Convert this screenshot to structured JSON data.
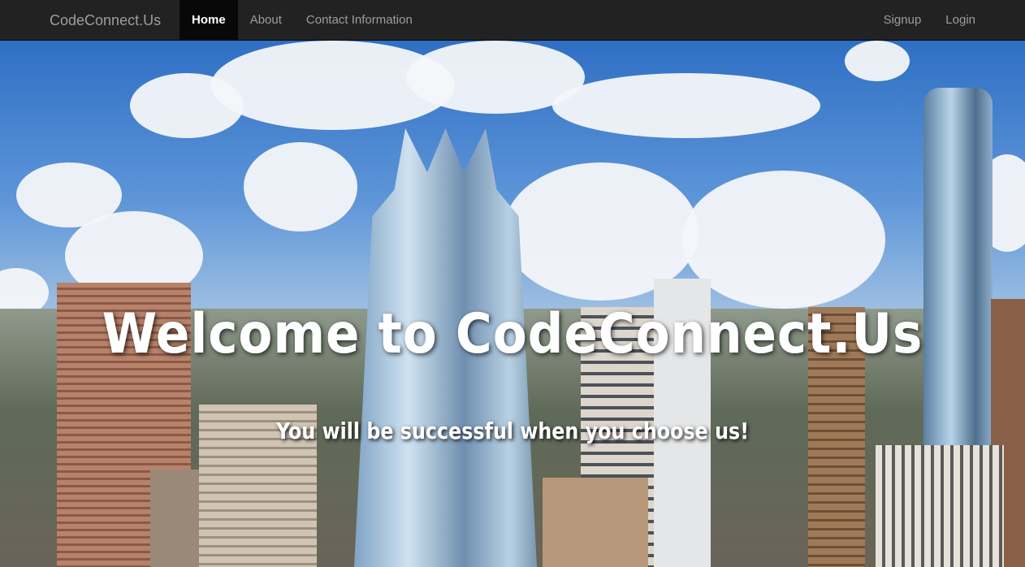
{
  "navbar": {
    "brand": "CodeConnect.Us",
    "left_links": [
      {
        "label": "Home",
        "active": true
      },
      {
        "label": "About",
        "active": false
      },
      {
        "label": "Contact Information",
        "active": false
      }
    ],
    "right_links": [
      {
        "label": "Signup"
      },
      {
        "label": "Login"
      }
    ]
  },
  "hero": {
    "title": "Welcome to CodeConnect.Us",
    "subtitle": "You will be successful when you choose us!",
    "background": "city-skyline-photo"
  },
  "colors": {
    "navbar_bg": "#222222",
    "nav_active_bg": "#080808",
    "nav_text": "#9d9d9d",
    "nav_active_text": "#ffffff",
    "hero_text": "#ffffff"
  }
}
